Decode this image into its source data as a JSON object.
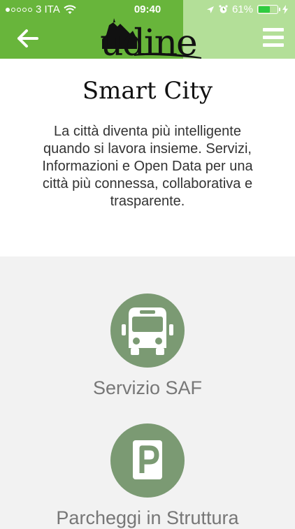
{
  "status": {
    "carrier": "3 ITA",
    "time": "09:40",
    "battery": "61%",
    "battery_level": 0.61
  },
  "header": {
    "logo": "udine",
    "back_icon": "arrow-left-icon",
    "menu_icon": "hamburger-menu-icon"
  },
  "intro": {
    "title": "Smart City",
    "description": "La città diventa più intelligente quando si lavora insieme. Servizi, Informazioni e Open Data per una città più connessa, collaborativa e trasparente."
  },
  "services": [
    {
      "label": "Servizio SAF",
      "icon": "bus-icon"
    },
    {
      "label": "Parcheggi in Struttura",
      "icon": "parking-icon"
    }
  ],
  "colors": {
    "header_green": "#68b53b",
    "header_light_green": "#b3df98",
    "icon_circle": "#7b9a73",
    "background": "#f2f2f2"
  }
}
